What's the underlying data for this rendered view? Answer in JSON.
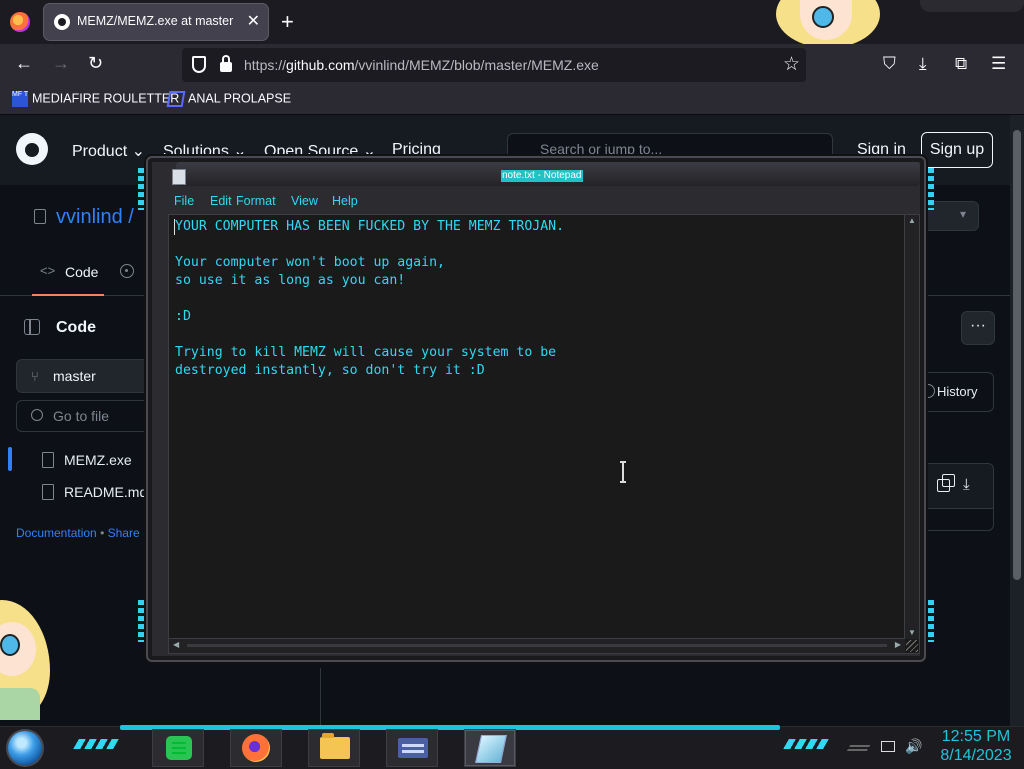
{
  "browser": {
    "tab": {
      "title": "MEMZ/MEMZ.exe at master · vvinlind/MEMZ"
    },
    "url": {
      "prefix": "https://",
      "host": "github.com",
      "path": "/vvinlind/MEMZ/blob/master/MEMZ.exe"
    },
    "bookmarks": [
      {
        "label": "MEDIAFIRE ROULETTER",
        "icon_text": "MF T",
        "icon": "mediafire-icon"
      },
      {
        "label": "ANAL PROLAPSE",
        "icon": "bookmark-icon"
      }
    ]
  },
  "github": {
    "nav": [
      "Product",
      "Solutions",
      "Open Source",
      "Pricing"
    ],
    "search_placeholder": "Search or jump to...",
    "sign_in": "Sign in",
    "sign_up": "Sign up",
    "repo_owner": "vvinlind /",
    "tabs": {
      "code": "Code"
    },
    "sidebar": {
      "title": "Code",
      "branch": "master",
      "goto_placeholder": "Go to file",
      "files": [
        "MEMZ.exe",
        "README.md"
      ],
      "links": [
        "Documentation",
        "Share"
      ]
    },
    "history_label": "History",
    "more_label": "···"
  },
  "notepad": {
    "title": "note.txt - Notepad",
    "menu": [
      "File",
      "Edit",
      "Format",
      "View",
      "Help"
    ],
    "text": "YOUR COMPUTER HAS BEEN FUCKED BY THE MEMZ TROJAN.\n\nYour computer won't boot up again,\nso use it as long as you can!\n\n:D\n\nTrying to kill MEMZ will cause your system to be\ndestroyed instantly, so don't try it :D",
    "accent_color": "#2fd9f2"
  },
  "taskbar": {
    "apps": [
      "app-1",
      "firefox",
      "file-explorer",
      "window-manager",
      "notepad"
    ],
    "time": "12:55 PM",
    "date": "8/14/2023",
    "accent_color": "#1fc4da"
  }
}
